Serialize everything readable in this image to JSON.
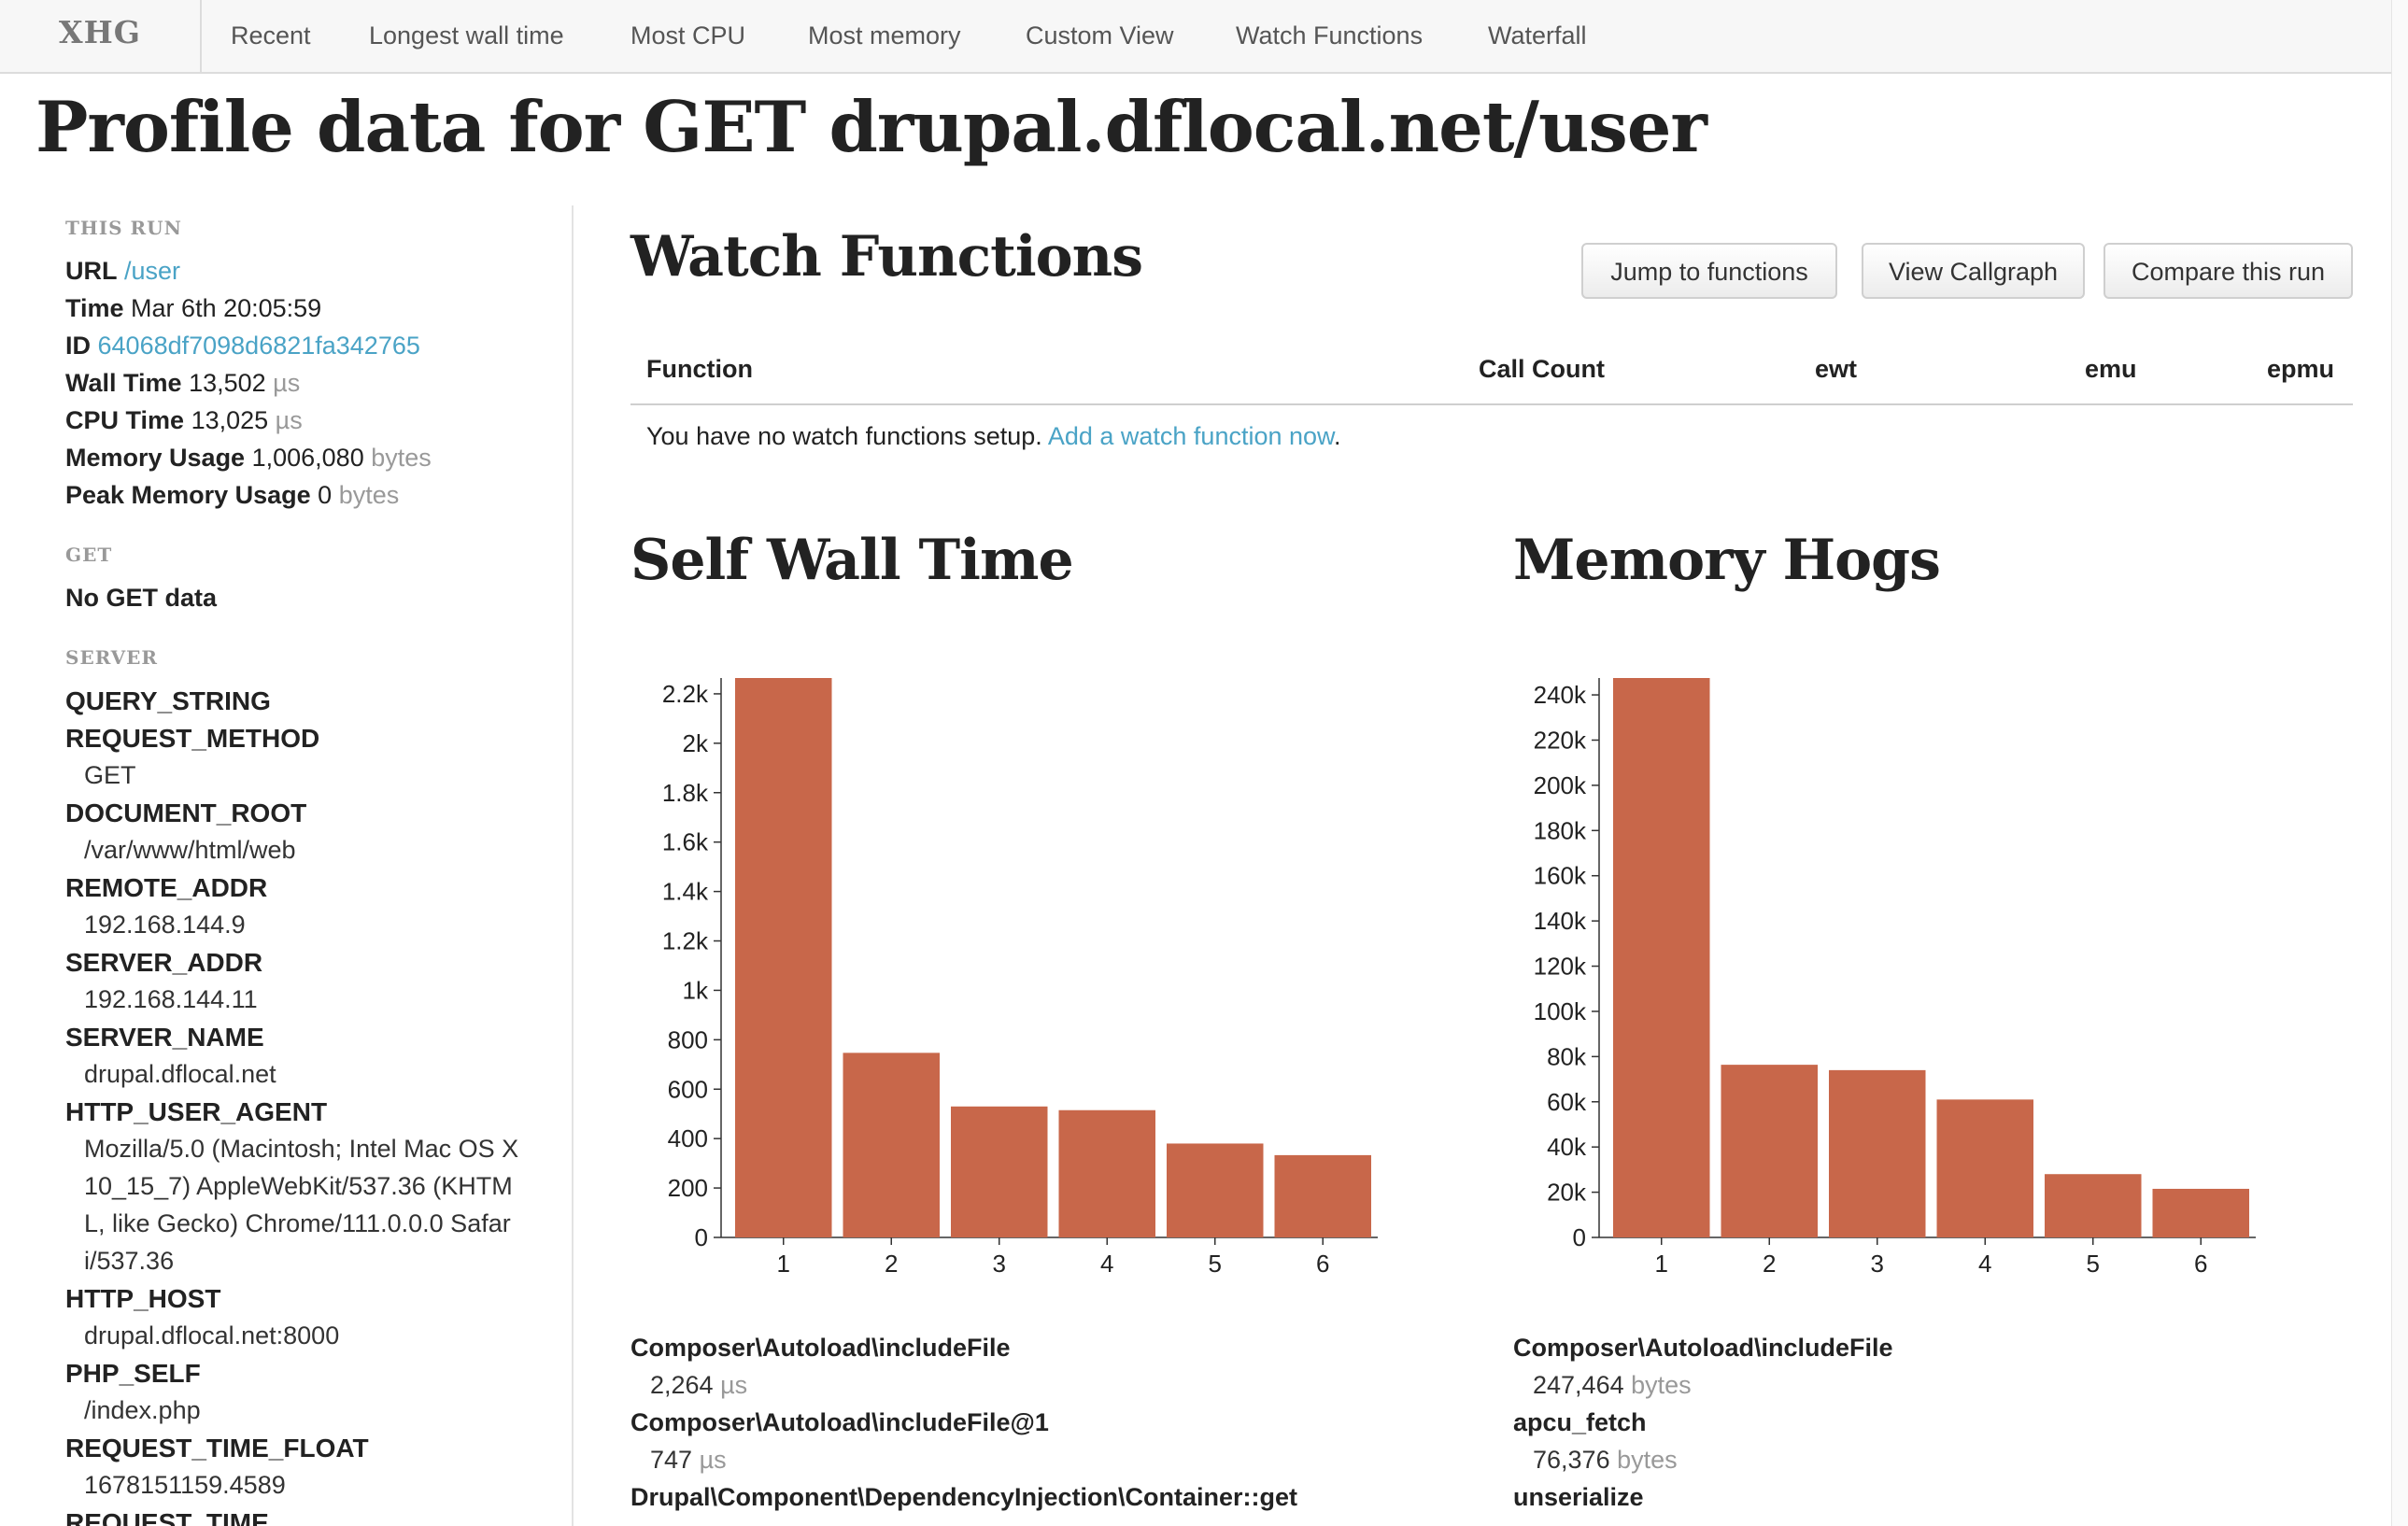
{
  "nav": {
    "brand": "XHG",
    "items": [
      "Recent",
      "Longest wall time",
      "Most CPU",
      "Most memory",
      "Custom View",
      "Watch Functions",
      "Waterfall"
    ]
  },
  "page_title": "Profile data for GET drupal.dflocal.net/user",
  "sidebar": {
    "this_run": {
      "title": "THIS RUN",
      "url_label": "URL",
      "url_value": "/user",
      "time_label": "Time",
      "time_value": "Mar 6th 20:05:59",
      "id_label": "ID",
      "id_value": "64068df7098d6821fa342765",
      "wall_label": "Wall Time",
      "wall_value": "13,502",
      "wall_unit": "µs",
      "cpu_label": "CPU Time",
      "cpu_value": "13,025",
      "cpu_unit": "µs",
      "mem_label": "Memory Usage",
      "mem_value": "1,006,080",
      "mem_unit": "bytes",
      "peak_label": "Peak Memory Usage",
      "peak_value": "0",
      "peak_unit": "bytes"
    },
    "get": {
      "title": "GET",
      "empty": "No GET data"
    },
    "server": {
      "title": "SERVER",
      "query_string_key": "QUERY_STRING",
      "request_method_key": "REQUEST_METHOD",
      "request_method_val": "GET",
      "document_root_key": "DOCUMENT_ROOT",
      "document_root_val": "/var/www/html/web",
      "remote_addr_key": "REMOTE_ADDR",
      "remote_addr_val": "192.168.144.9",
      "server_addr_key": "SERVER_ADDR",
      "server_addr_val": "192.168.144.11",
      "server_name_key": "SERVER_NAME",
      "server_name_val": "drupal.dflocal.net",
      "user_agent_key": "HTTP_USER_AGENT",
      "user_agent_line1": "Mozilla/5.0 (Macintosh; Intel Mac OS X",
      "user_agent_line2": "10_15_7) AppleWebKit/537.36 (KHTM",
      "user_agent_line3": "L, like Gecko) Chrome/111.0.0.0 Safar",
      "user_agent_line4": "i/537.36",
      "http_host_key": "HTTP_HOST",
      "http_host_val": "drupal.dflocal.net:8000",
      "php_self_key": "PHP_SELF",
      "php_self_val": "/index.php",
      "request_time_float_key": "REQUEST_TIME_FLOAT",
      "request_time_float_val": "1678151159.4589",
      "request_time_key": "REQUEST_TIME"
    }
  },
  "watch": {
    "title": "Watch Functions",
    "buttons": {
      "jump": "Jump to functions",
      "callgraph": "View Callgraph",
      "compare": "Compare this run"
    },
    "columns": {
      "function": "Function",
      "call_count": "Call Count",
      "ewt": "ewt",
      "emu": "emu",
      "epmu": "epmu"
    },
    "empty_text": "You have no watch functions setup.",
    "empty_link": "Add a watch function now",
    "empty_period": "."
  },
  "self_wall": {
    "title": "Self Wall Time",
    "functions": [
      {
        "name": "Composer\\Autoload\\includeFile",
        "value": "2,264",
        "unit": "µs"
      },
      {
        "name": "Composer\\Autoload\\includeFile@1",
        "value": "747",
        "unit": "µs"
      },
      {
        "name": "Drupal\\Component\\DependencyInjection\\Container::get"
      }
    ]
  },
  "memory_hogs": {
    "title": "Memory Hogs",
    "functions": [
      {
        "name": "Composer\\Autoload\\includeFile",
        "value": "247,464",
        "unit": "bytes"
      },
      {
        "name": "apcu_fetch",
        "value": "76,376",
        "unit": "bytes"
      },
      {
        "name": "unserialize"
      }
    ]
  },
  "chart_data": [
    {
      "type": "bar",
      "categories": [
        "1",
        "2",
        "3",
        "4",
        "5",
        "6"
      ],
      "values": [
        2264,
        747,
        530,
        515,
        380,
        333
      ],
      "ylim": [
        0,
        2264
      ],
      "yticks": [
        0,
        200,
        400,
        600,
        800,
        1000,
        1200,
        1400,
        1600,
        1800,
        2000,
        2200
      ],
      "ytick_labels": [
        "0",
        "200",
        "400",
        "600",
        "800",
        "1k",
        "1.2k",
        "1.4k",
        "1.6k",
        "1.8k",
        "2k",
        "2.2k"
      ],
      "color": "#c8674a",
      "grid": false
    },
    {
      "type": "bar",
      "categories": [
        "1",
        "2",
        "3",
        "4",
        "5",
        "6"
      ],
      "values": [
        247464,
        76376,
        74000,
        61000,
        28000,
        21500
      ],
      "ylim": [
        0,
        247464
      ],
      "yticks": [
        0,
        20000,
        40000,
        60000,
        80000,
        100000,
        120000,
        140000,
        160000,
        180000,
        200000,
        220000,
        240000
      ],
      "ytick_labels": [
        "0",
        "20k",
        "40k",
        "60k",
        "80k",
        "100k",
        "120k",
        "140k",
        "160k",
        "180k",
        "200k",
        "220k",
        "240k"
      ],
      "color": "#c8674a",
      "grid": false
    }
  ]
}
